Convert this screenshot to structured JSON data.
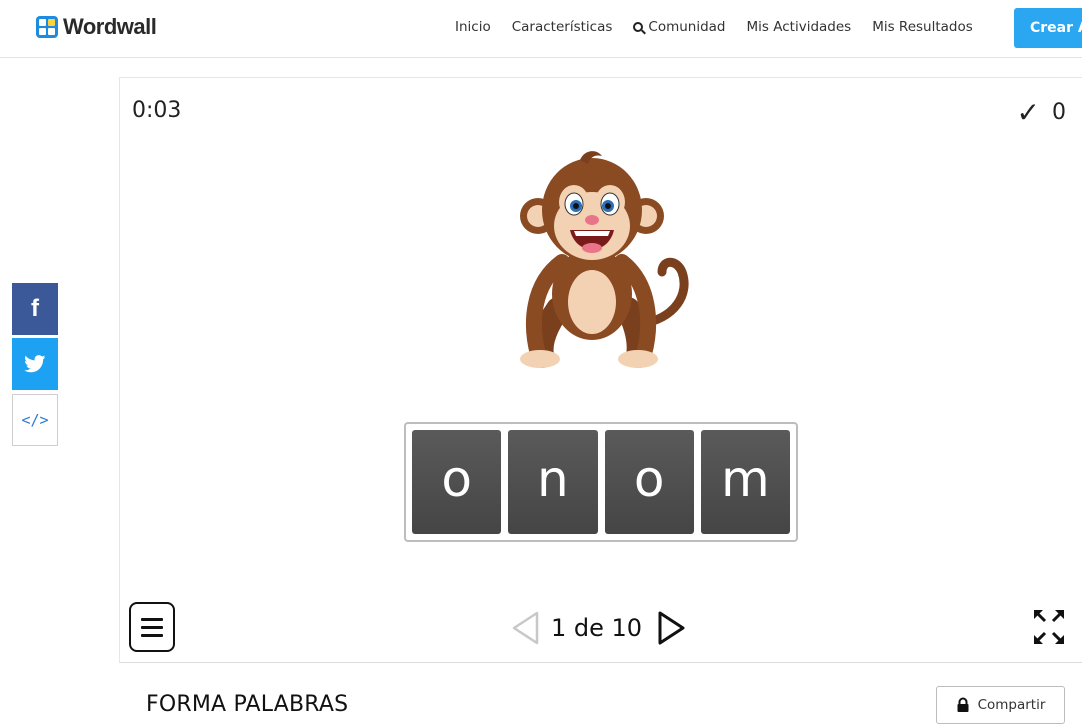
{
  "header": {
    "brand": "Wordwall",
    "nav": [
      {
        "label": "Inicio"
      },
      {
        "label": "Características"
      },
      {
        "label": "Comunidad",
        "icon": "search-icon"
      },
      {
        "label": "Mis Actividades"
      },
      {
        "label": "Mis Resultados"
      }
    ],
    "create_label": "Crear A"
  },
  "share_sidebar": {
    "facebook_glyph": "f",
    "embed_glyph": "</>"
  },
  "activity": {
    "timer": "0:03",
    "score": "0",
    "score_icon": "check-icon",
    "image_icon": "monkey-illustration",
    "tiles": [
      "o",
      "n",
      "o",
      "m"
    ],
    "pager": {
      "text": "1 de 10"
    },
    "title": "FORMA PALABRAS",
    "share_label": "Compartir"
  },
  "colors": {
    "accent": "#2ba6f0",
    "facebook": "#3b5998",
    "twitter": "#1da1f2",
    "tile": "#4f4f4f"
  }
}
